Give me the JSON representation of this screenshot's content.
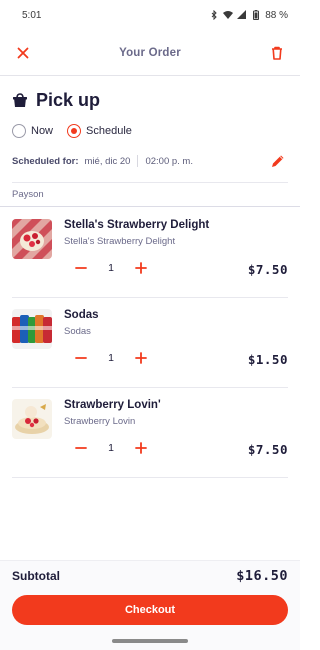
{
  "status_bar": {
    "time": "5:01",
    "battery": "88 %"
  },
  "header": {
    "title": "Your Order"
  },
  "pickup": {
    "title": "Pick up",
    "option_now": "Now",
    "option_schedule": "Schedule",
    "selected": "Schedule"
  },
  "schedule": {
    "label": "Scheduled for:",
    "date": "mié, dic 20",
    "time": "02:00 p. m."
  },
  "store": {
    "name": "Payson"
  },
  "items": [
    {
      "name": "Stella's Strawberry Delight",
      "subtitle": "Stella's Strawberry Delight",
      "quantity": "1",
      "price": "$7.50"
    },
    {
      "name": "Sodas",
      "subtitle": "Sodas",
      "quantity": "1",
      "price": "$1.50"
    },
    {
      "name": "Strawberry Lovin'",
      "subtitle": "Strawberry Lovin",
      "quantity": "1",
      "price": "$7.50"
    }
  ],
  "summary": {
    "subtotal_label": "Subtotal",
    "subtotal_value": "$16.50",
    "checkout_label": "Checkout"
  },
  "colors": {
    "accent": "#f23a1d",
    "text_primary": "#1f1d3a",
    "text_secondary": "#6b6a8a"
  },
  "icons": {
    "close": "close-icon",
    "delete": "trash-icon",
    "pickup": "bag-icon",
    "edit": "pencil-icon",
    "decrease": "minus-icon",
    "increase": "plus-icon"
  }
}
